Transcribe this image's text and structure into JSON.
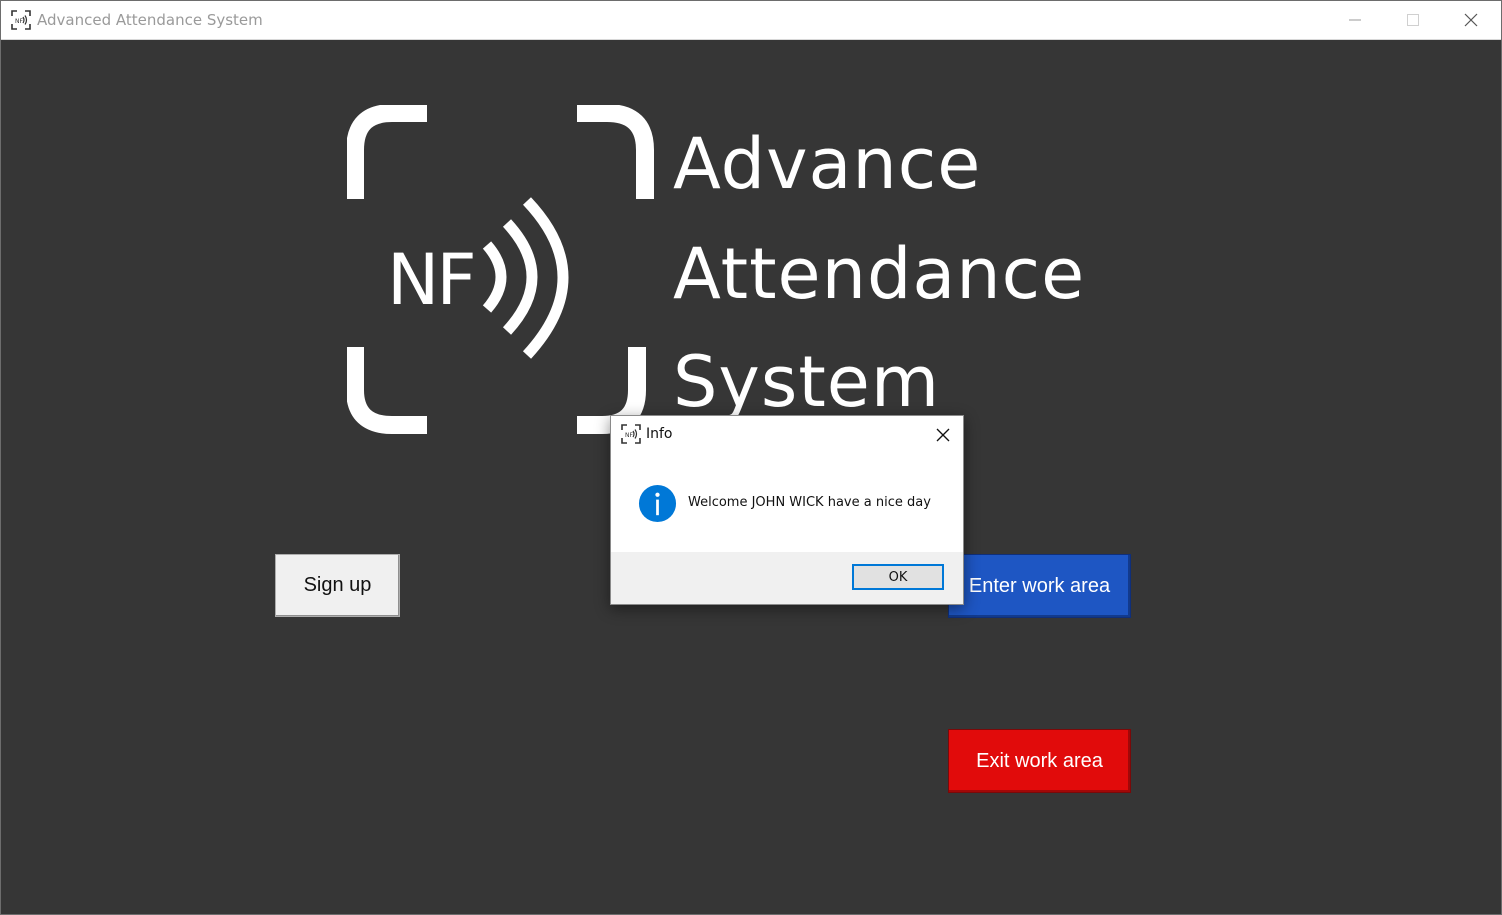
{
  "window": {
    "title": "Advanced Attendance System",
    "icon": "nfc-scan-icon",
    "controls": [
      "minimize-icon",
      "maximize-icon",
      "close-icon"
    ]
  },
  "logo": {
    "badge_text": "NF",
    "lines": [
      "Advance",
      "Attendance",
      "System"
    ],
    "color": "#ffffff"
  },
  "buttons": {
    "signup": "Sign up",
    "enter": "Enter work area",
    "exit": "Exit work area"
  },
  "dialog": {
    "title": "Info",
    "icon": "info-icon",
    "message": "Welcome JOHN WICK have a nice day",
    "ok_label": "OK"
  },
  "colors": {
    "background": "#363636",
    "enter_button": "#1e56c3",
    "exit_button": "#e10b0b",
    "info_icon": "#0078d7"
  }
}
